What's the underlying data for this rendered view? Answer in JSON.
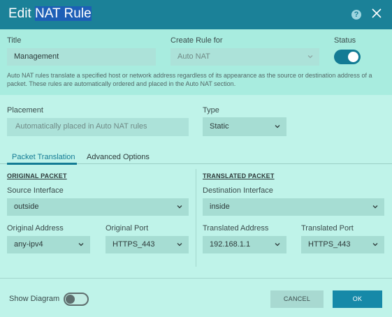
{
  "dialog": {
    "title_prefix": "Edit ",
    "title_highlight": "NAT Rule",
    "help_glyph": "?"
  },
  "general": {
    "title_label": "Title",
    "title_value": "Management",
    "create_rule_label": "Create Rule for",
    "create_rule_value": "Auto NAT",
    "status_label": "Status",
    "status_on": true,
    "description": "Auto NAT rules translate a specified host or network address regardless of its appearance as the source or destination address of a packet. These rules are automatically ordered and placed in the Auto NAT section."
  },
  "placement": {
    "label": "Placement",
    "value": "Automatically placed in Auto NAT rules"
  },
  "type": {
    "label": "Type",
    "value": "Static"
  },
  "tabs": [
    {
      "label": "Packet Translation",
      "active": true
    },
    {
      "label": "Advanced Options",
      "active": false
    }
  ],
  "original_packet": {
    "heading": "ORIGINAL PACKET",
    "source_interface_label": "Source Interface",
    "source_interface_value": "outside",
    "address_label": "Original Address",
    "address_value": "any-ipv4",
    "port_label": "Original Port",
    "port_value": "HTTPS_443"
  },
  "translated_packet": {
    "heading": "TRANSLATED PACKET",
    "destination_interface_label": "Destination Interface",
    "destination_interface_value": "inside",
    "address_label": "Translated Address",
    "address_value": "192.168.1.1",
    "port_label": "Translated Port",
    "port_value": "HTTPS_443"
  },
  "footer": {
    "show_diagram_label": "Show Diagram",
    "show_diagram_on": false,
    "cancel_label": "CANCEL",
    "ok_label": "OK"
  },
  "colors": {
    "header": "#1b8198",
    "body": "#bff3e9",
    "accent": "#137b94",
    "ok_button": "#1689a8"
  },
  "icons": {
    "help": "help-circle-icon",
    "close": "close-icon",
    "dropdown": "chevron-down-icon"
  }
}
